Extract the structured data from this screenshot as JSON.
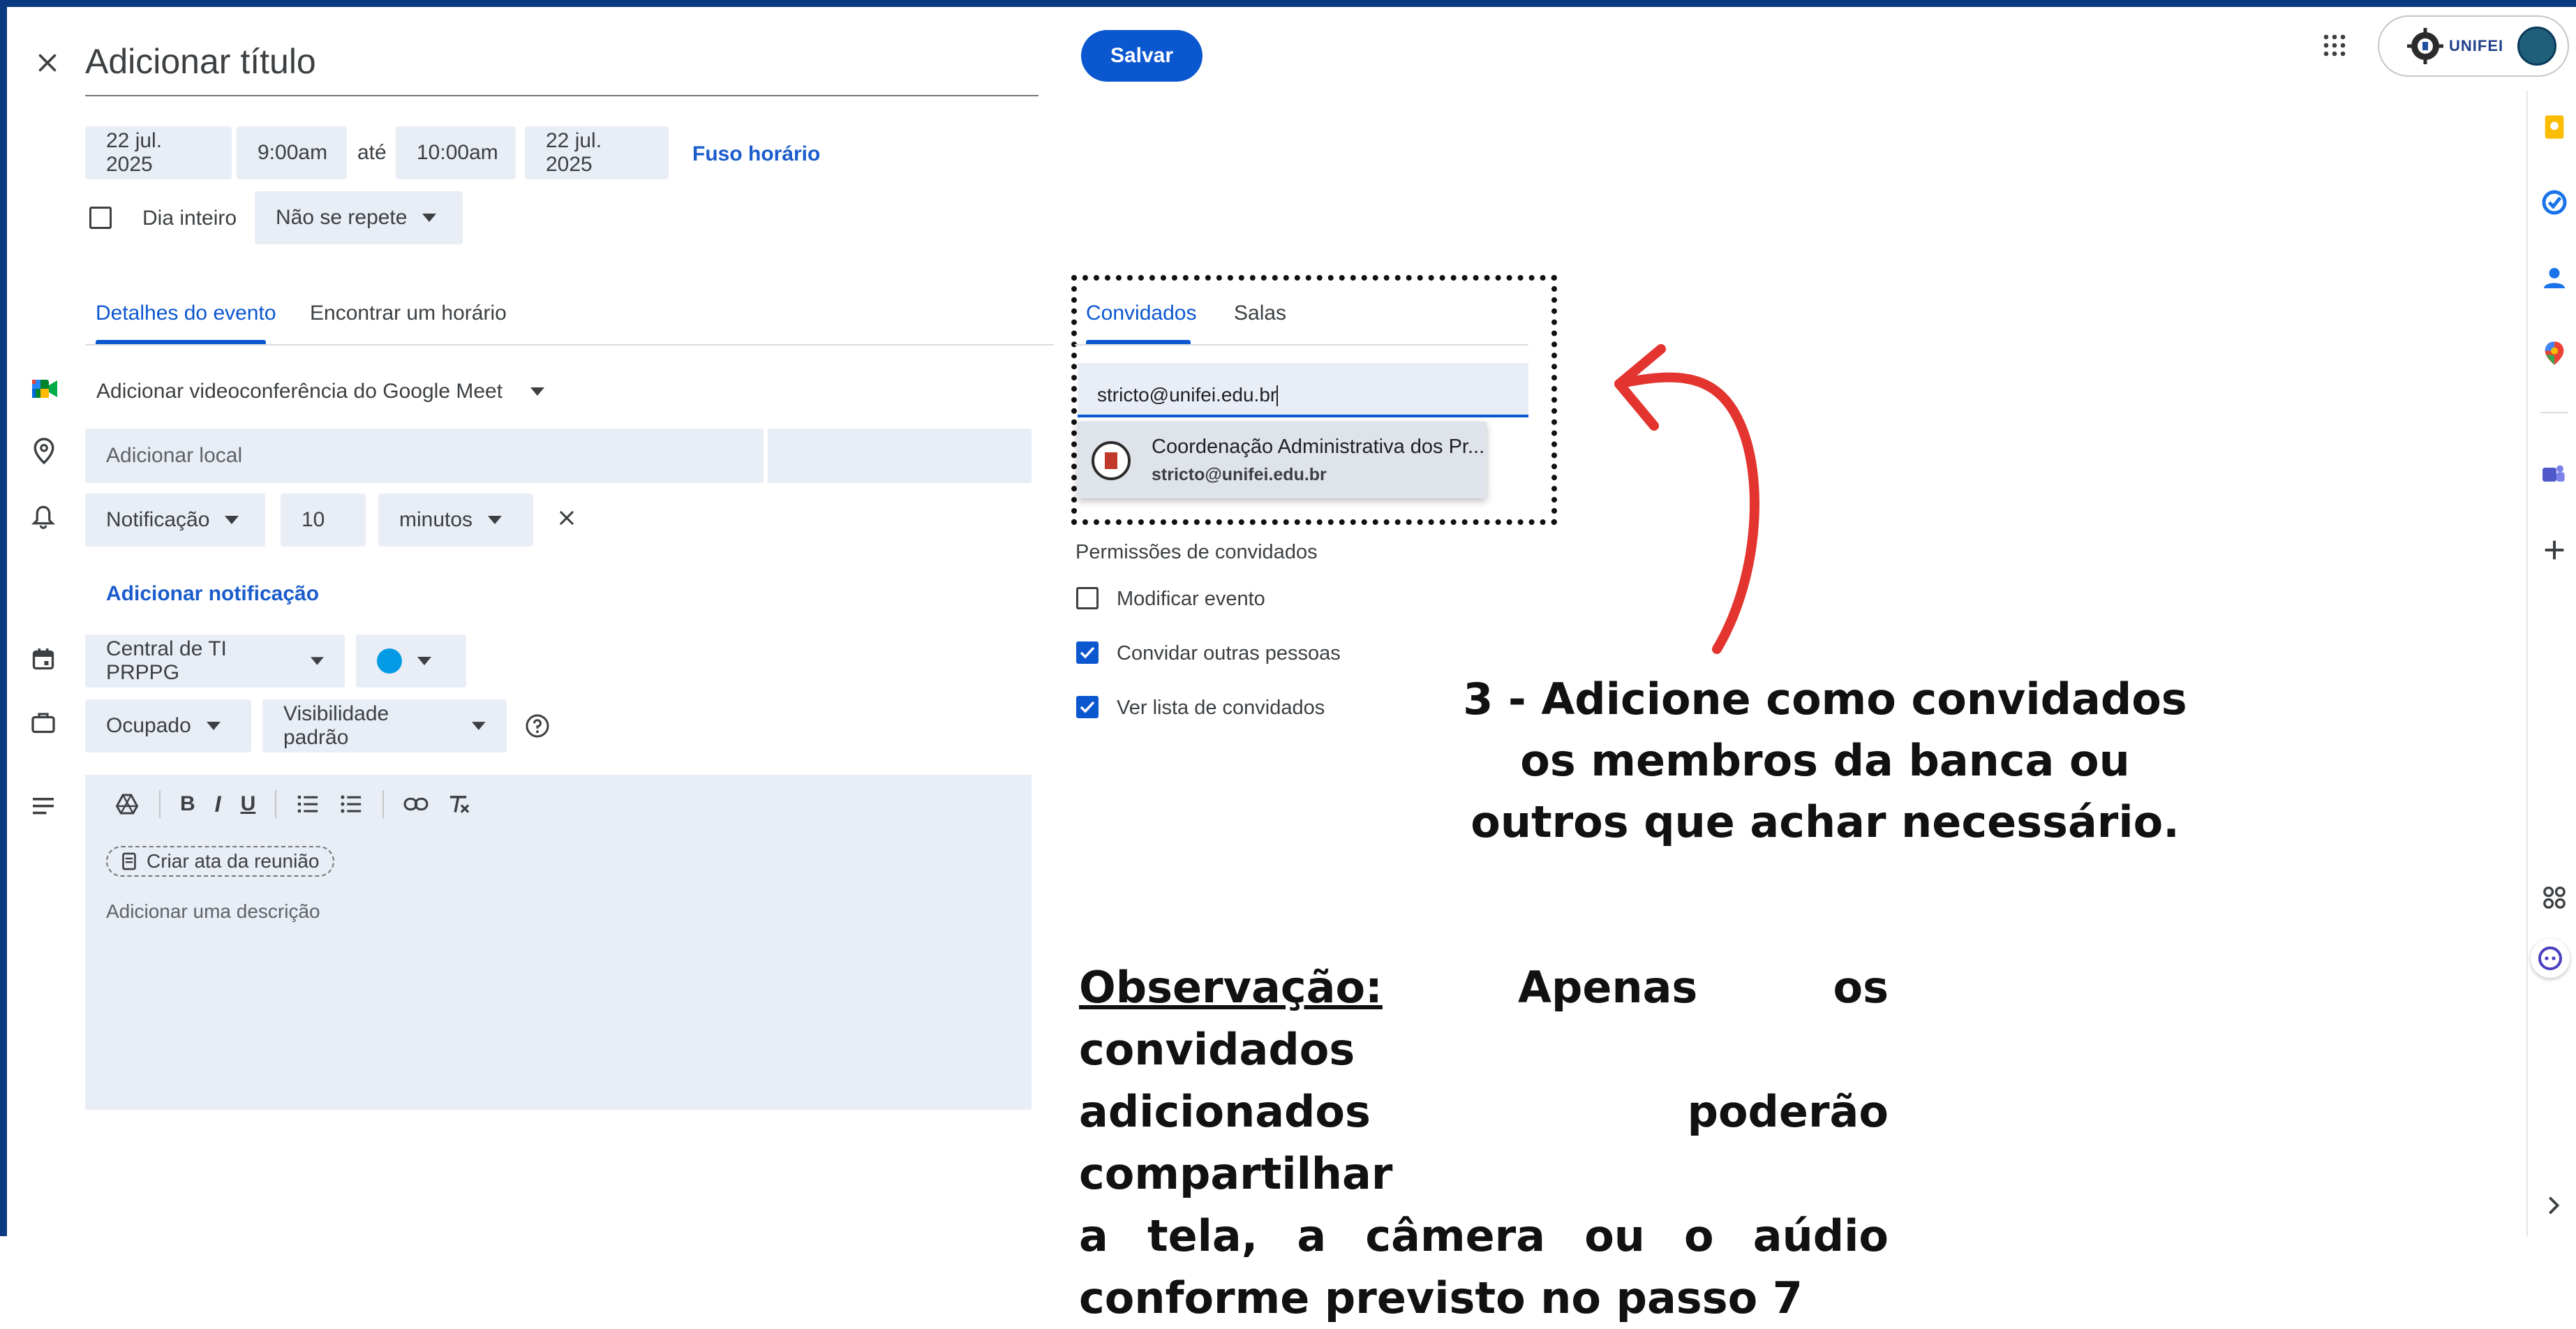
{
  "header": {
    "close_label": "×",
    "title_placeholder": "Adicionar título",
    "save_label": "Salvar",
    "account_logo_text": "UNIFEI"
  },
  "datetime": {
    "start_date": "22 jul. 2025",
    "start_time": "9:00am",
    "until": "até",
    "end_time": "10:00am",
    "end_date": "22 jul. 2025",
    "timezone": "Fuso horário",
    "all_day": "Dia inteiro",
    "repeat": "Não se repete"
  },
  "tabs_left": {
    "details": "Detalhes do evento",
    "find_time": "Encontrar um horário"
  },
  "details": {
    "meet": "Adicionar videoconferência do Google Meet",
    "location_placeholder": "Adicionar local",
    "notification_type": "Notificação",
    "notification_value": "10",
    "notification_unit": "minutos",
    "add_notification": "Adicionar notificação",
    "calendar": "Central de TI PRPPG",
    "calendar_color": "#039be5",
    "busy": "Ocupado",
    "visibility": "Visibilidade padrão",
    "create_notes": "Criar ata da reunião",
    "description_placeholder": "Adicionar uma descrição"
  },
  "guests": {
    "tab_guests": "Convidados",
    "tab_rooms": "Salas",
    "input_value": "stricto@unifei.edu.br",
    "suggestion_name": "Coordenação Administrativa dos Pr...",
    "suggestion_email": "stricto@unifei.edu.br",
    "permissions_title": "Permissões de convidados",
    "perm_modify": "Modificar evento",
    "perm_invite": "Convidar outras pessoas",
    "perm_see_list": "Ver lista de convidados"
  },
  "annotations": {
    "step_line1": "3 - Adicione como convidados",
    "step_line2": "os membros da banca ou",
    "step_line3": "outros que achar necessário.",
    "obs_label": "Observação:",
    "obs_line1_rest": " Apenas os convidados",
    "obs_line2": "adicionados poderão compartilhar",
    "obs_line3": "a tela, a câmera ou o aúdio",
    "obs_line4": "conforme previsto no passo 7",
    "arrow_color": "#e3342f"
  },
  "colors": {
    "accent": "#0b57d0",
    "field_bg": "#e8edf6",
    "frame": "#0b3a82"
  }
}
